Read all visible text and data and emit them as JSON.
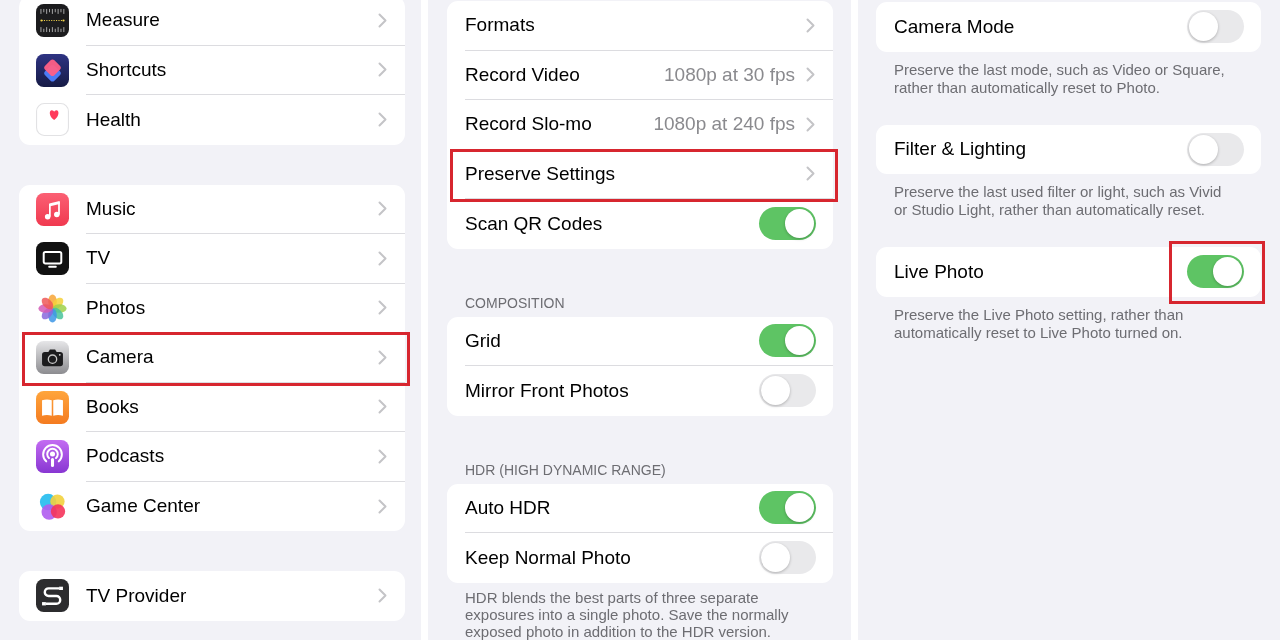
{
  "panels": [
    {
      "sections": [
        {
          "rows": [
            {
              "kind": "app",
              "label": "Measure",
              "highlighted": false
            },
            {
              "kind": "app",
              "label": "Shortcuts",
              "highlighted": false
            },
            {
              "kind": "app",
              "label": "Health",
              "highlighted": false
            }
          ]
        },
        {
          "rows": [
            {
              "kind": "app",
              "label": "Music",
              "highlighted": false
            },
            {
              "kind": "app",
              "label": "TV",
              "highlighted": false
            },
            {
              "kind": "app",
              "label": "Photos",
              "highlighted": false
            },
            {
              "kind": "app",
              "label": "Camera",
              "highlighted": true
            },
            {
              "kind": "app",
              "label": "Books",
              "highlighted": false
            },
            {
              "kind": "app",
              "label": "Podcasts",
              "highlighted": false
            },
            {
              "kind": "app",
              "label": "Game Center",
              "highlighted": false
            }
          ]
        },
        {
          "rows": [
            {
              "kind": "app",
              "label": "TV Provider",
              "highlighted": false
            }
          ]
        }
      ]
    },
    {
      "sections": [
        {
          "rows": [
            {
              "kind": "link",
              "label": "Formats",
              "highlighted": false
            },
            {
              "kind": "link",
              "label": "Record Video",
              "value": "1080p at 30 fps",
              "highlighted": false
            },
            {
              "kind": "link",
              "label": "Record Slo-mo",
              "value": "1080p at 240 fps",
              "highlighted": false
            },
            {
              "kind": "link",
              "label": "Preserve Settings",
              "highlighted": true
            },
            {
              "kind": "toggle",
              "label": "Scan QR Codes",
              "on": true,
              "highlighted": false
            }
          ]
        },
        {
          "header": "COMPOSITION",
          "rows": [
            {
              "kind": "toggle",
              "label": "Grid",
              "on": true,
              "highlighted": false
            },
            {
              "kind": "toggle",
              "label": "Mirror Front Photos",
              "on": false,
              "highlighted": false
            }
          ]
        },
        {
          "header": "HDR (HIGH DYNAMIC RANGE)",
          "rows": [
            {
              "kind": "toggle",
              "label": "Auto HDR",
              "on": true,
              "highlighted": false
            },
            {
              "kind": "toggle",
              "label": "Keep Normal Photo",
              "on": false,
              "highlighted": false
            }
          ],
          "footer": "HDR blends the best parts of three separate exposures into a single photo. Save the normally exposed photo in addition to the HDR version."
        }
      ]
    },
    {
      "sections": [
        {
          "rows": [
            {
              "kind": "toggle",
              "label": "Camera Mode",
              "on": false,
              "highlighted": false
            }
          ],
          "footer": "Preserve the last mode, such as Video or Square, rather than automatically reset to Photo."
        },
        {
          "rows": [
            {
              "kind": "toggle",
              "label": "Filter & Lighting",
              "on": false,
              "highlighted": false
            }
          ],
          "footer": "Preserve the last used filter or light, such as Vivid or Studio Light, rather than automatically reset."
        },
        {
          "rows": [
            {
              "kind": "toggle",
              "label": "Live Photo",
              "on": true,
              "highlighted": true
            }
          ],
          "footer": "Preserve the Live Photo setting, rather than automatically reset to Live Photo turned on."
        }
      ]
    }
  ]
}
